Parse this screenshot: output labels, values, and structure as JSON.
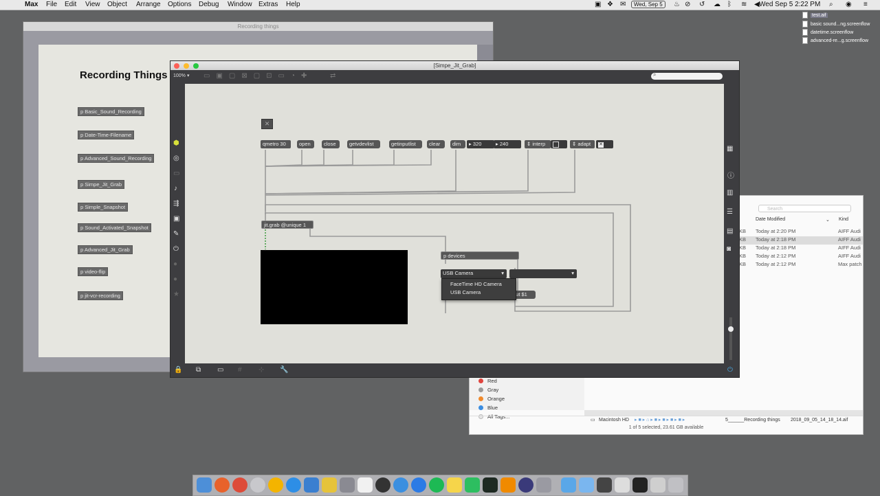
{
  "menubar": {
    "app": "Max",
    "items": [
      "File",
      "Edit",
      "View",
      "Object",
      "Arrange",
      "Options",
      "Debug",
      "Window",
      "Extras",
      "Help"
    ],
    "date_badge": "Wed, Sep 5",
    "clock": "Wed Sep 5  2:22 PM"
  },
  "desktop_files": [
    "test.aif",
    "basic sound...ng.screenflow",
    "datetime.screenflow",
    "advanced-re...g.screenflow"
  ],
  "back_window": {
    "title": "Recording things",
    "heading": "Recording Things",
    "subpatches": [
      "p Basic_Sound_Recording",
      "p Date-Time-Filename",
      "p Advanced_Sound_Recording",
      "p Simpe_Jit_Grab",
      "p Simple_Snapshot",
      "p Sound_Activated_Snapshot",
      "p Advanced_Jit_Grab",
      "p video-flip",
      "p jit-vcr-recording"
    ]
  },
  "finder": {
    "search_placeholder": "Search",
    "col_date": "Date Modified",
    "col_kind": "Kind",
    "rows": [
      {
        "size": "KB",
        "date": "Today at 2:20 PM",
        "kind": "AIFF Audi"
      },
      {
        "size": "KB",
        "date": "Today at 2:18 PM",
        "kind": "AIFF Audi"
      },
      {
        "size": "KB",
        "date": "Today at 2:18 PM",
        "kind": "AIFF Audi"
      },
      {
        "size": "KB",
        "date": "Today at 2:12 PM",
        "kind": "AIFF Audi"
      },
      {
        "size": "KB",
        "date": "Today at 2:12 PM",
        "kind": "Max patch"
      }
    ],
    "tags": [
      {
        "label": "Red",
        "color": "#e0443e"
      },
      {
        "label": "Gray",
        "color": "#9a9a9a"
      },
      {
        "label": "Orange",
        "color": "#f08a2c"
      },
      {
        "label": "Blue",
        "color": "#3b8de0"
      },
      {
        "label": "All Tags...",
        "color": "#e6e6e6"
      }
    ],
    "path": [
      "Macintosh HD",
      "5______Recording things",
      "2018_09_05_14_18_14.aif"
    ],
    "status": "1 of 5 selected, 23.61 GB available"
  },
  "front_window": {
    "title": "[Simpe_Jit_Grab]",
    "zoom": "100%",
    "objects": {
      "qmetro": "qmetro 30",
      "open": "open",
      "close": "close",
      "getvdevlist": "getvdevlist",
      "getinputlist": "getinputlist",
      "clear": "clear",
      "dim": "dim",
      "dim_w": "320",
      "dim_h": "240",
      "interp": "interp",
      "adapt": "adapt",
      "jitgrab": "jit.grab @unique 1",
      "devices": "p devices",
      "menu_value": "USB Camera",
      "input_msg": "put $1"
    },
    "dropdown_options": [
      "FaceTime HD Camera",
      "USB Camera"
    ]
  }
}
